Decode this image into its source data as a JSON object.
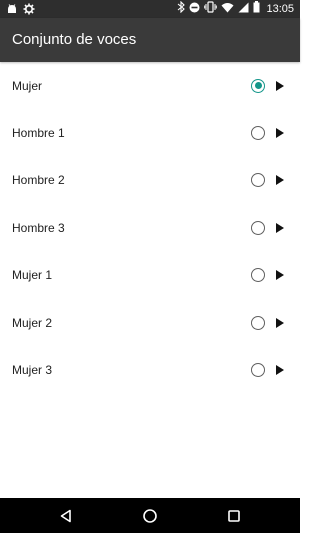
{
  "status_bar": {
    "time": "13:05",
    "left_icons": [
      "android-icon",
      "settings-gear-icon"
    ],
    "right_icons": [
      "bluetooth-icon",
      "do-not-disturb-icon",
      "vibrate-icon",
      "wifi-icon",
      "signal-icon",
      "battery-icon"
    ]
  },
  "app_bar": {
    "title": "Conjunto de voces"
  },
  "voices": [
    {
      "label": "Mujer",
      "selected": true
    },
    {
      "label": "Hombre 1",
      "selected": false
    },
    {
      "label": "Hombre 2",
      "selected": false
    },
    {
      "label": "Hombre 3",
      "selected": false
    },
    {
      "label": "Mujer 1",
      "selected": false
    },
    {
      "label": "Mujer 2",
      "selected": false
    },
    {
      "label": "Mujer 3",
      "selected": false
    }
  ],
  "nav_bar": {
    "buttons": [
      "back-icon",
      "home-icon",
      "recents-icon"
    ]
  },
  "colors": {
    "accent": "#14968a",
    "status_bar": "#2e2e2e",
    "app_bar": "#3a3a3a",
    "nav_bar": "#000000"
  }
}
